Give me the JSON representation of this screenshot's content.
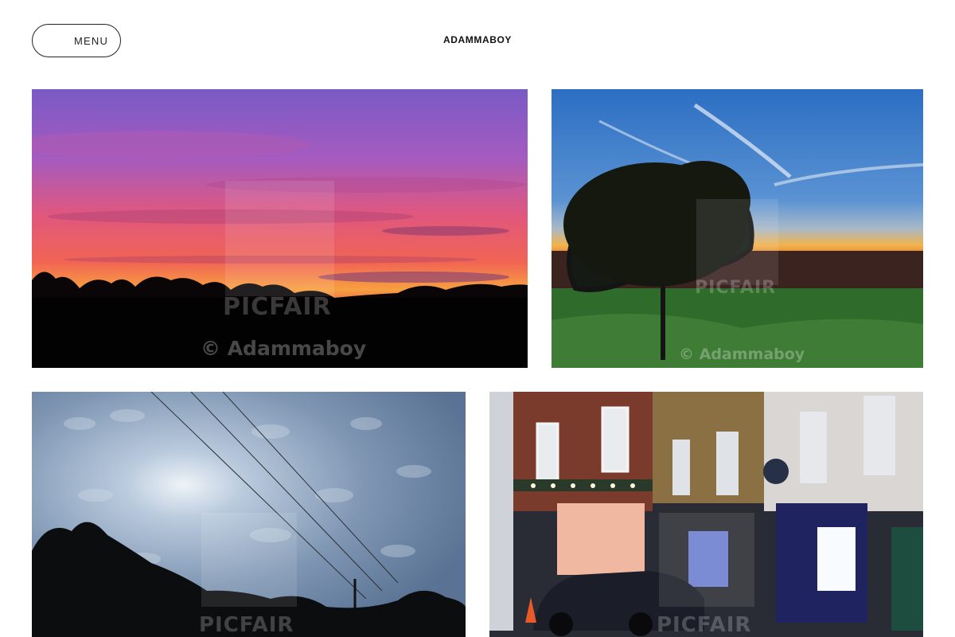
{
  "header": {
    "menu_label": "MENU",
    "site_title": "ADAMMABOY"
  },
  "gallery": {
    "photos": [
      {
        "subject": "pink and purple sunset sky over silhouetted trees",
        "watermark_logo": "PICFAIR",
        "watermark_copyright": "© Adammaboy"
      },
      {
        "subject": "tree silhouette at sunset over green field and blue sky",
        "watermark_logo": "PICFAIR",
        "watermark_copyright": "© Adammaboy"
      },
      {
        "subject": "mackerel sky clouds with power lines over silhouetted trees",
        "watermark_logo": "PICFAIR"
      },
      {
        "subject": "town street shopfronts at dusk with dark car",
        "watermark_logo": "PICFAIR"
      }
    ]
  }
}
